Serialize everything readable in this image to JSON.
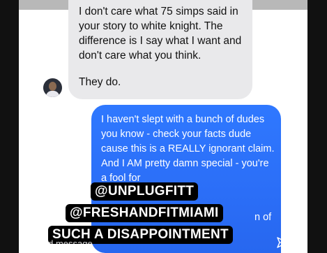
{
  "incoming": {
    "message": "I don't care what 75 simps said in your story to white knight. The difference is I say what I want and don't care what you think.",
    "followup": "They do."
  },
  "outgoing": {
    "message": "I haven't slept with a bunch of dudes you know - check your facts dude cause this is a REALLY ignorant claim. And I AM pretty damn special - you're a fool for",
    "fragment": "n of"
  },
  "overlay": {
    "line1": "@UNPLUGFITT",
    "line2": "@FRESHANDFITMIAMI",
    "line3": "SUCH A DISAPPOINTMENT"
  },
  "composer": {
    "placeholder": "Send message",
    "send_icon": "paper-plane-icon"
  },
  "colors": {
    "incoming_bubble": "#e9e9eb",
    "outgoing_bubble": "#2b6ef7",
    "overlay_bg": "#000000"
  }
}
